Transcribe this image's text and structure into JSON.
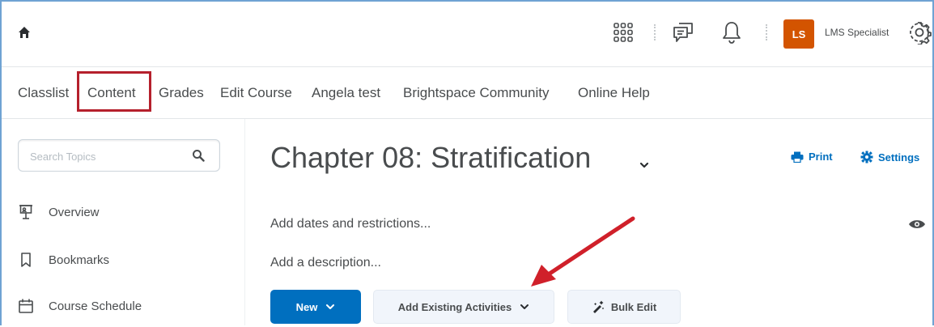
{
  "topbar": {
    "avatar_initials": "LS",
    "user_name": "LMS Specialist",
    "icons": [
      "home-icon",
      "app-grid-icon",
      "chat-icon",
      "bell-icon",
      "gear-icon"
    ]
  },
  "nav": {
    "items": [
      "Classlist",
      "Content",
      "Grades",
      "Edit Course",
      "Angela test",
      "Brightspace Community",
      "Online Help"
    ],
    "highlighted": "Content"
  },
  "sidebar": {
    "search_placeholder": "Search Topics",
    "items": [
      {
        "label": "Overview",
        "icon": "presentation-icon"
      },
      {
        "label": "Bookmarks",
        "icon": "bookmark-icon"
      },
      {
        "label": "Course Schedule",
        "icon": "calendar-icon"
      }
    ]
  },
  "main": {
    "title": "Chapter 08: Stratification",
    "print_label": "Print",
    "settings_label": "Settings",
    "dates_text": "Add dates and restrictions...",
    "description_text": "Add a description...",
    "new_button": "New",
    "add_existing_button": "Add Existing Activities",
    "bulk_edit_button": "Bulk Edit"
  },
  "colors": {
    "accent": "#006fbf",
    "avatar": "#d35400",
    "highlight": "#b5202c",
    "arrow": "#d0202a"
  }
}
